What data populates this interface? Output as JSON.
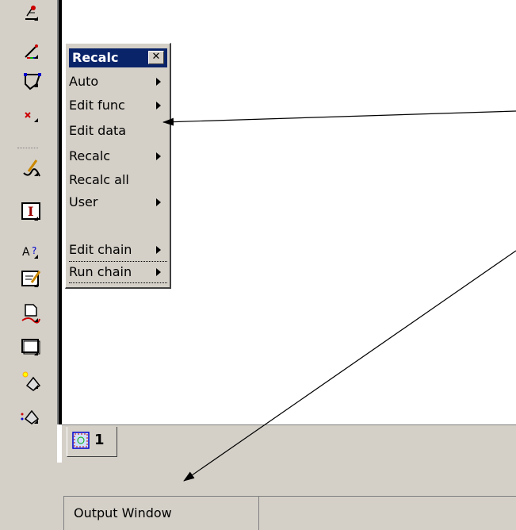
{
  "toolbar": {
    "tools": [
      {
        "icon": "dimension-tool-icon"
      },
      {
        "icon": "line-tool-icon"
      },
      {
        "icon": "polygon-tool-icon"
      },
      {
        "icon": "point-tool-icon"
      },
      {
        "icon": "sketch-tool-icon"
      },
      {
        "icon": "text-tool-icon"
      },
      {
        "icon": "attribute-tool-icon"
      },
      {
        "icon": "edit-note-tool-icon"
      },
      {
        "icon": "document-tool-icon"
      },
      {
        "icon": "frame-tool-icon"
      },
      {
        "icon": "light-tool-icon"
      },
      {
        "icon": "image-tool-icon"
      }
    ]
  },
  "recalc_menu": {
    "title": "Recalc",
    "close_glyph": "✕",
    "items": [
      {
        "label": "Auto",
        "submenu": true
      },
      {
        "label": "Edit func",
        "submenu": true
      },
      {
        "label": "Edit data",
        "submenu": false
      },
      {
        "label": "Recalc",
        "submenu": true
      },
      {
        "label": "Recalc all",
        "submenu": false
      },
      {
        "label": "User",
        "submenu": true
      },
      {
        "label": "Edit chain",
        "submenu": true
      },
      {
        "label": "Run chain",
        "submenu": true
      }
    ]
  },
  "tabbar": {
    "tab_number": "1"
  },
  "output": {
    "label": "Output Window"
  }
}
